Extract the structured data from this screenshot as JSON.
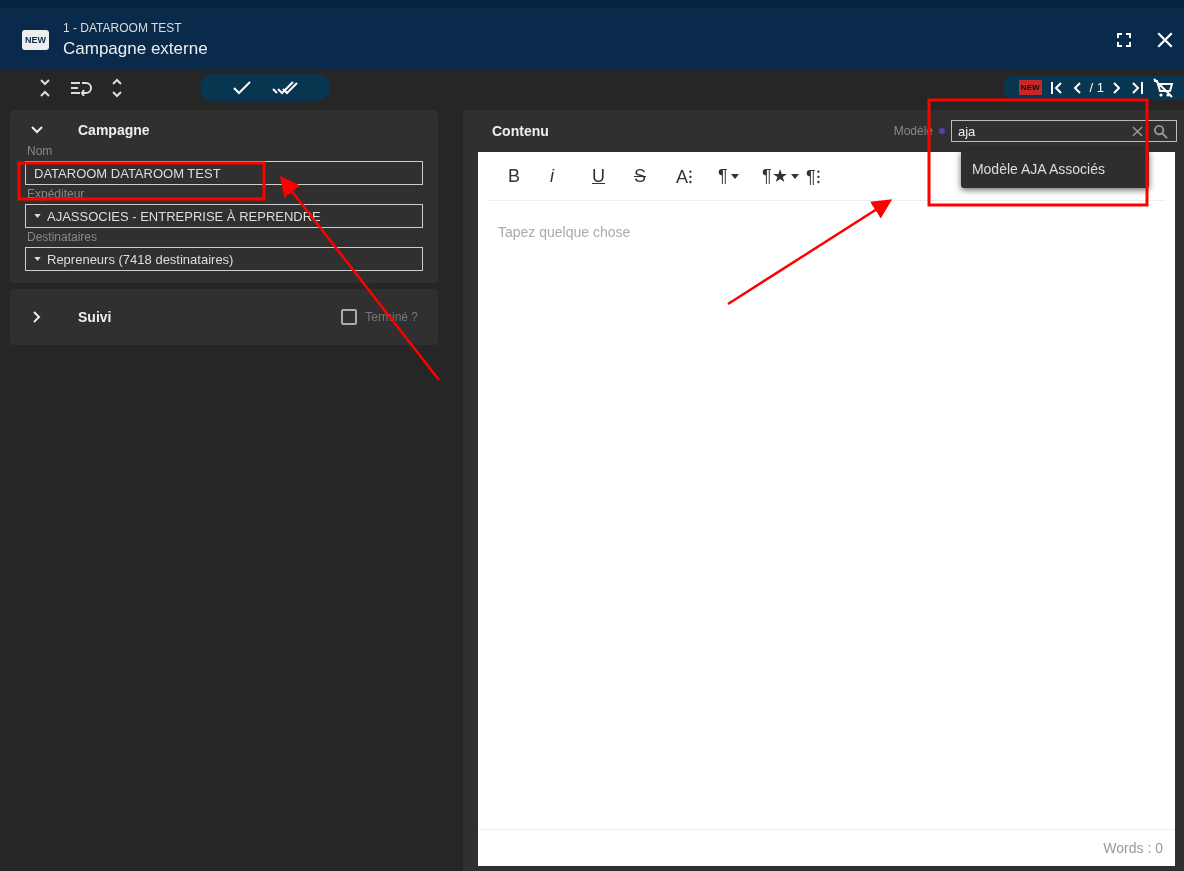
{
  "header": {
    "badge": "NEW",
    "subtitle": "1 - DATAROOM TEST",
    "title": "Campagne externe"
  },
  "pager": {
    "badge": "NEW",
    "page": "/ 1"
  },
  "campagne": {
    "title": "Campagne",
    "expanded": true,
    "fields": [
      {
        "label": "Nom",
        "value": "DATAROOM DATAROOM TEST",
        "kind": "text"
      },
      {
        "label": "Expéditeur",
        "value": "AJASSOCIES - ENTREPRISE À REPRENDRE",
        "kind": "select"
      },
      {
        "label": "Destinataires",
        "value": "Repreneurs (7418 destinataires)",
        "kind": "select"
      }
    ]
  },
  "suivi": {
    "title": "Suivi",
    "expanded": false,
    "done": {
      "label": "Terminé ?",
      "checked": false
    }
  },
  "contenu": {
    "title": "Contenu",
    "model_label": "Modèle",
    "model_search": "aja",
    "suggestions": [
      "Modèle AJA Associés"
    ],
    "tools": [
      {
        "label": "B",
        "kind": "bold"
      },
      {
        "label": "i",
        "kind": "italic"
      },
      {
        "label": "U",
        "kind": "underline"
      },
      {
        "label": "S",
        "kind": "strike"
      },
      {
        "label": "A⁝",
        "kind": "plain"
      },
      {
        "label": "¶",
        "kind": "menu"
      },
      {
        "label": "¶★",
        "kind": "menu"
      },
      {
        "label": "¶⁝",
        "kind": "plain"
      }
    ],
    "placeholder": "Tapez quelque chose",
    "word_count": "Words : 0"
  }
}
